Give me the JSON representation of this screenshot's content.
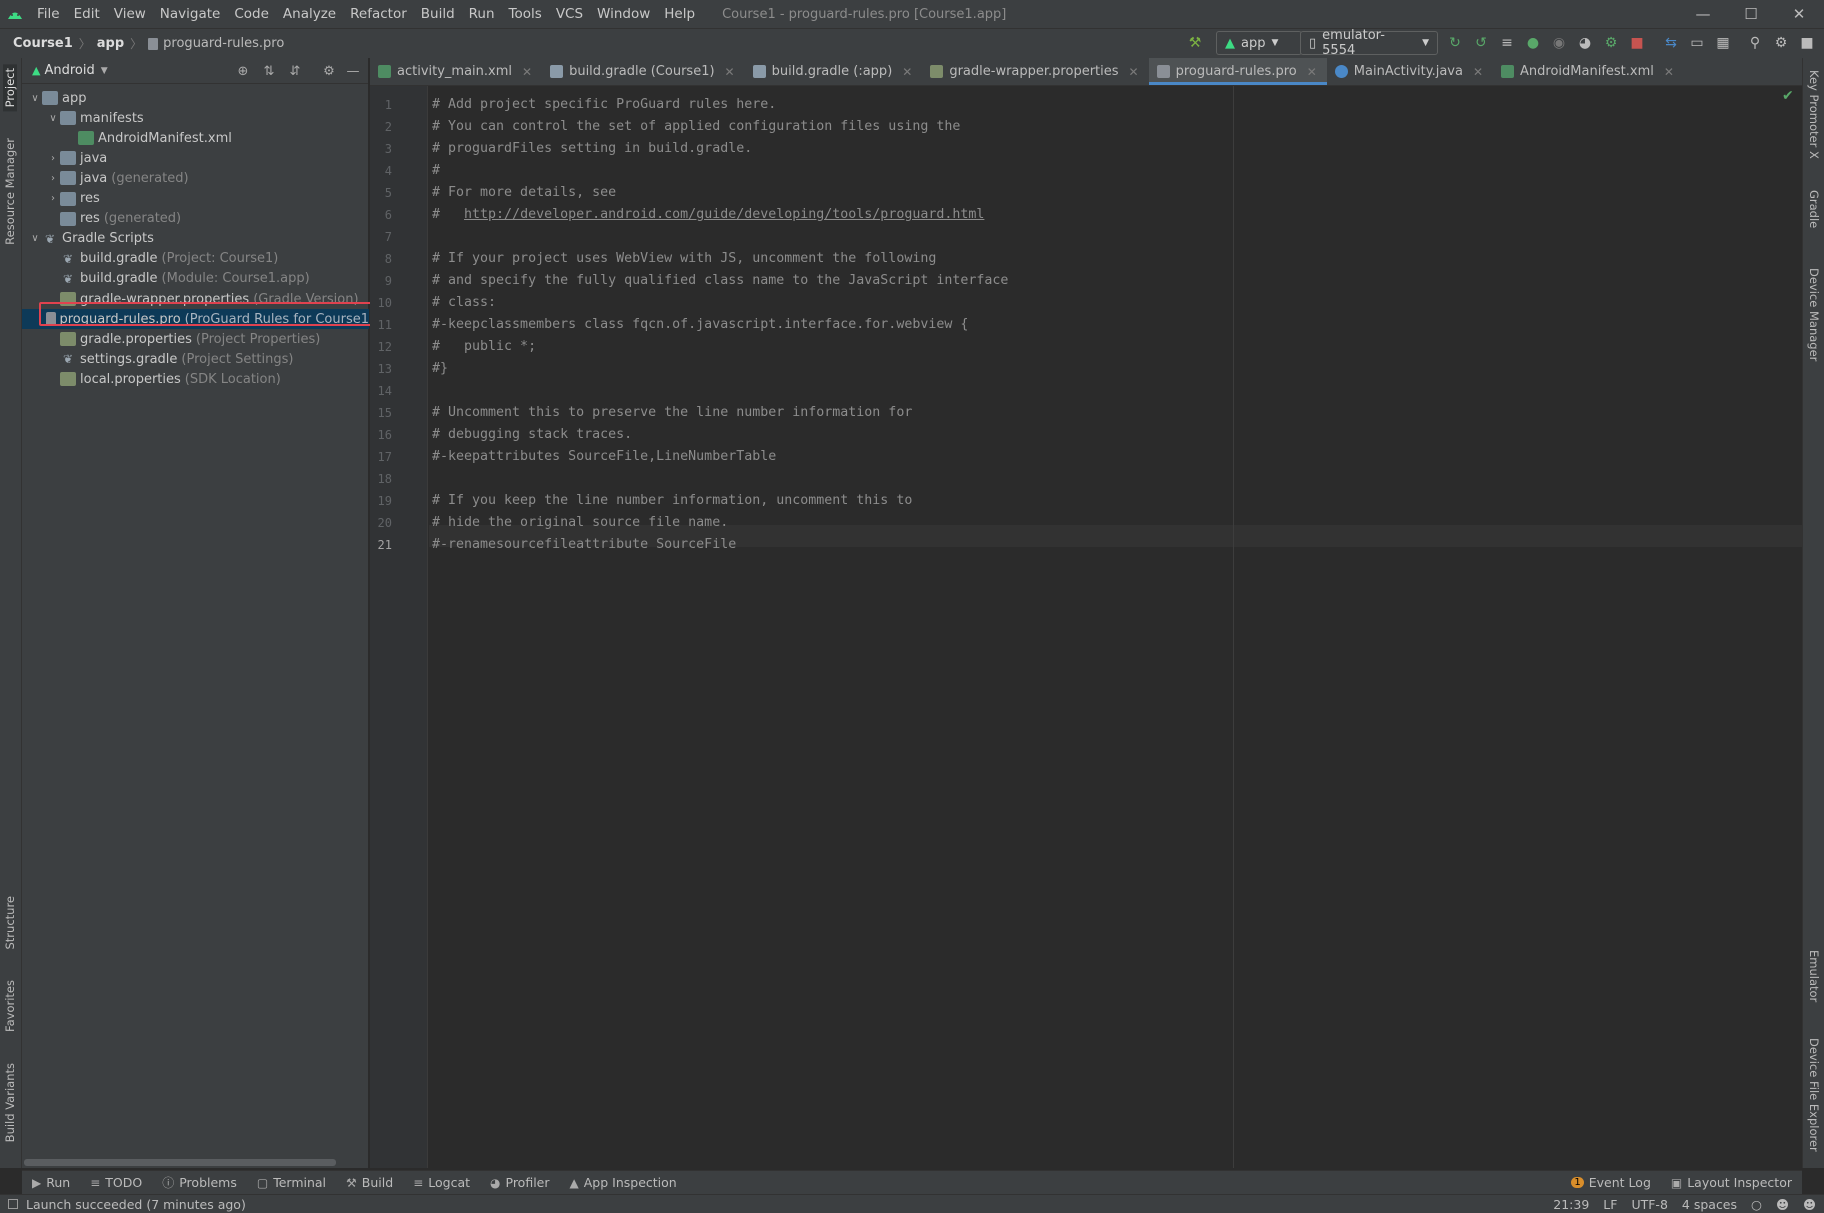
{
  "menubar": {
    "items": [
      "File",
      "Edit",
      "View",
      "Navigate",
      "Code",
      "Analyze",
      "Refactor",
      "Build",
      "Run",
      "Tools",
      "VCS",
      "Window",
      "Help"
    ],
    "title": "Course1 - proguard-rules.pro [Course1.app]"
  },
  "navbar": {
    "crumbs": [
      "Course1",
      "app",
      "proguard-rules.pro"
    ],
    "run_config": "app",
    "device": "emulator-5554"
  },
  "project_panel": {
    "view_mode": "Android",
    "tree": [
      {
        "label": "app",
        "muted": "",
        "icon": "folder-icon",
        "depth": 0,
        "arrow": "down"
      },
      {
        "label": "manifests",
        "muted": "",
        "icon": "folder-icon",
        "depth": 1,
        "arrow": "down"
      },
      {
        "label": "AndroidManifest.xml",
        "muted": "",
        "icon": "xml-file-icon",
        "depth": 2,
        "arrow": ""
      },
      {
        "label": "java",
        "muted": "",
        "icon": "folder-icon",
        "depth": 1,
        "arrow": "right"
      },
      {
        "label": "java",
        "muted": "(generated)",
        "icon": "folder-icon",
        "depth": 1,
        "arrow": "right"
      },
      {
        "label": "res",
        "muted": "",
        "icon": "folder-icon",
        "depth": 1,
        "arrow": "right"
      },
      {
        "label": "res",
        "muted": "(generated)",
        "icon": "folder-icon",
        "depth": 1,
        "arrow": ""
      },
      {
        "label": "Gradle Scripts",
        "muted": "",
        "icon": "gradle-icon",
        "depth": 0,
        "arrow": "down"
      },
      {
        "label": "build.gradle",
        "muted": "(Project: Course1)",
        "icon": "gradle-icon",
        "depth": 1,
        "arrow": ""
      },
      {
        "label": "build.gradle",
        "muted": "(Module: Course1.app)",
        "icon": "gradle-icon",
        "depth": 1,
        "arrow": ""
      },
      {
        "label": "gradle-wrapper.properties",
        "muted": "(Gradle Version)",
        "icon": "properties-icon",
        "depth": 1,
        "arrow": ""
      },
      {
        "label": "proguard-rules.pro",
        "muted": "(ProGuard Rules for Course1",
        "icon": "file-icon",
        "depth": 1,
        "arrow": "",
        "selected": true
      },
      {
        "label": "gradle.properties",
        "muted": "(Project Properties)",
        "icon": "properties-icon",
        "depth": 1,
        "arrow": ""
      },
      {
        "label": "settings.gradle",
        "muted": "(Project Settings)",
        "icon": "gradle-icon",
        "depth": 1,
        "arrow": ""
      },
      {
        "label": "local.properties",
        "muted": "(SDK Location)",
        "icon": "properties-icon",
        "depth": 1,
        "arrow": ""
      }
    ]
  },
  "editor_tabs": [
    {
      "label": "activity_main.xml",
      "icon": "xml-file-icon",
      "active": false
    },
    {
      "label": "build.gradle (Course1)",
      "icon": "gradle-icon",
      "active": false
    },
    {
      "label": "build.gradle (:app)",
      "icon": "gradle-icon",
      "active": false
    },
    {
      "label": "gradle-wrapper.properties",
      "icon": "properties-icon",
      "active": false
    },
    {
      "label": "proguard-rules.pro",
      "icon": "file-icon",
      "active": true
    },
    {
      "label": "MainActivity.java",
      "icon": "java-class-icon",
      "active": false
    },
    {
      "label": "AndroidManifest.xml",
      "icon": "xml-file-icon",
      "active": false
    }
  ],
  "editor": {
    "current_line": 21,
    "lines": [
      "# Add project specific ProGuard rules here.",
      "# You can control the set of applied configuration files using the",
      "# proguardFiles setting in build.gradle.",
      "#",
      "# For more details, see",
      "#   http://developer.android.com/guide/developing/tools/proguard.html",
      "",
      "# If your project uses WebView with JS, uncomment the following",
      "# and specify the fully qualified class name to the JavaScript interface",
      "# class:",
      "#-keepclassmembers class fqcn.of.javascript.interface.for.webview {",
      "#   public *;",
      "#}",
      "",
      "# Uncomment this to preserve the line number information for",
      "# debugging stack traces.",
      "#-keepattributes SourceFile,LineNumberTable",
      "",
      "# If you keep the line number information, uncomment this to",
      "# hide the original source file name.",
      "#-renamesourcefileattribute SourceFile"
    ],
    "link_text": "http://developer.android.com/guide/developing/tools/proguard.html"
  },
  "left_stripe": [
    "Project",
    "Resource Manager",
    "Structure",
    "Favorites",
    "Build Variants"
  ],
  "right_stripe": [
    "Key Promoter X",
    "Gradle",
    "Device Manager",
    "Emulator",
    "Device File Explorer"
  ],
  "bottom_tools": {
    "left": [
      "Run",
      "TODO",
      "Problems",
      "Terminal",
      "Build",
      "Logcat",
      "Profiler",
      "App Inspection"
    ],
    "right": [
      "Event Log",
      "Layout Inspector"
    ],
    "event_badge": "1"
  },
  "status": {
    "message": "Launch succeeded (7 minutes ago)",
    "position": "21:39",
    "line_sep": "LF",
    "encoding": "UTF-8",
    "indent": "4 spaces"
  },
  "colors": {
    "accent": "#4a88c7",
    "selection": "#0d3a58",
    "highlight_box": "#e0424f",
    "android_green": "#3ddc84"
  }
}
